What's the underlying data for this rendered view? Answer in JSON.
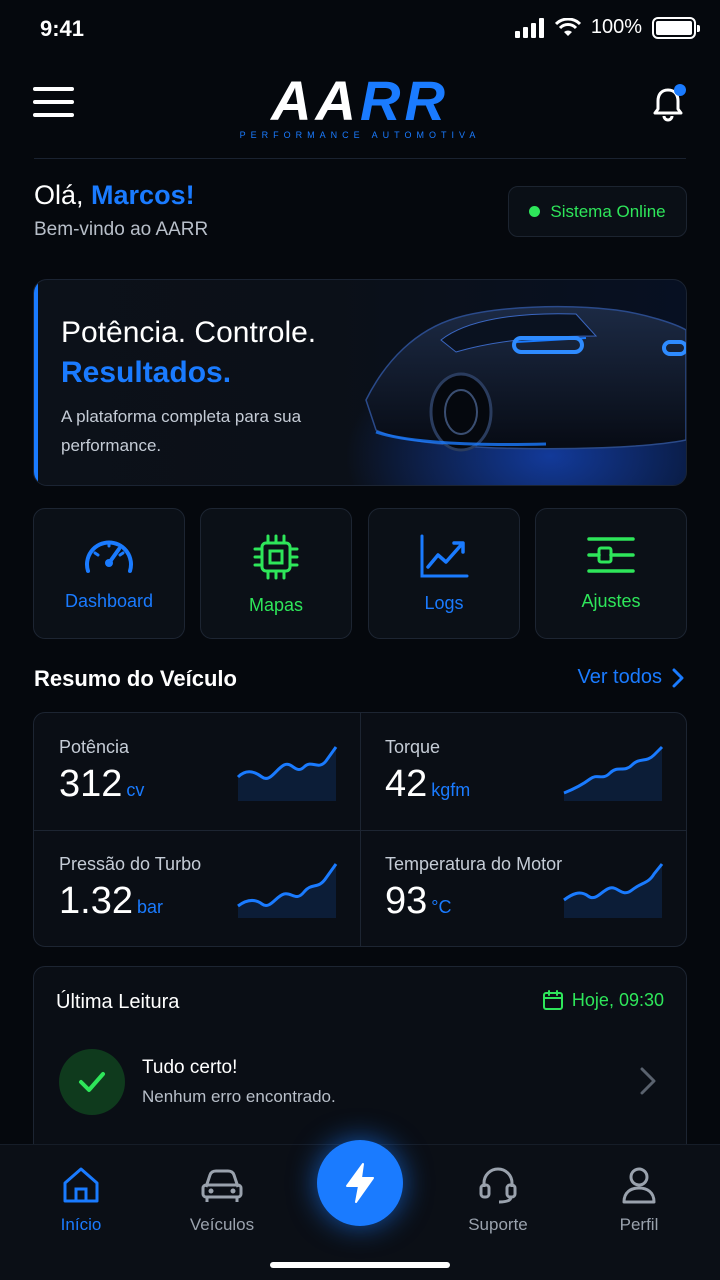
{
  "status_bar": {
    "time": "9:41",
    "battery": "100%"
  },
  "header": {
    "logo_white": "AA",
    "logo_blue": "RR",
    "logo_tagline": "PERFORMANCE AUTOMOTIVA"
  },
  "greeting": {
    "hello": "Olá,",
    "name": "Marcos!",
    "subtitle": "Bem-vindo ao AARR",
    "system_status": "Sistema Online"
  },
  "hero": {
    "line1": "Potência. Controle.",
    "line2": "Resultados.",
    "description": "A plataforma completa para sua performance."
  },
  "quick_actions": [
    {
      "label": "Dashboard",
      "icon": "speedometer-icon",
      "color": "#1a7bff"
    },
    {
      "label": "Mapas",
      "icon": "chip-icon",
      "color": "#2ee65a"
    },
    {
      "label": "Logs",
      "icon": "chart-line-icon",
      "color": "#1a7bff"
    },
    {
      "label": "Ajustes",
      "icon": "sliders-icon",
      "color": "#2ee65a"
    }
  ],
  "summary": {
    "title": "Resumo do Veículo",
    "see_all": "Ver todos",
    "metrics": [
      {
        "label": "Potência",
        "value": "312",
        "unit": "cv"
      },
      {
        "label": "Torque",
        "value": "42",
        "unit": "kgfm"
      },
      {
        "label": "Pressão do Turbo",
        "value": "1.32",
        "unit": "bar"
      },
      {
        "label": "Temperatura do Motor",
        "value": "93",
        "unit": "°C"
      }
    ]
  },
  "last_reading": {
    "title": "Última Leitura",
    "time": "Hoje, 09:30",
    "status_title": "Tudo certo!",
    "status_detail": "Nenhum erro encontrado."
  },
  "bottom_nav": {
    "items": [
      {
        "label": "Início",
        "icon": "home-icon",
        "active": true
      },
      {
        "label": "Veículos",
        "icon": "car-icon",
        "active": false
      },
      {
        "label": "Suporte",
        "icon": "headset-icon",
        "active": false
      },
      {
        "label": "Perfil",
        "icon": "user-icon",
        "active": false
      }
    ],
    "center_action": "lightning-icon"
  },
  "colors": {
    "accent": "#1a7bff",
    "success": "#2ee65a",
    "background": "#05080d"
  }
}
